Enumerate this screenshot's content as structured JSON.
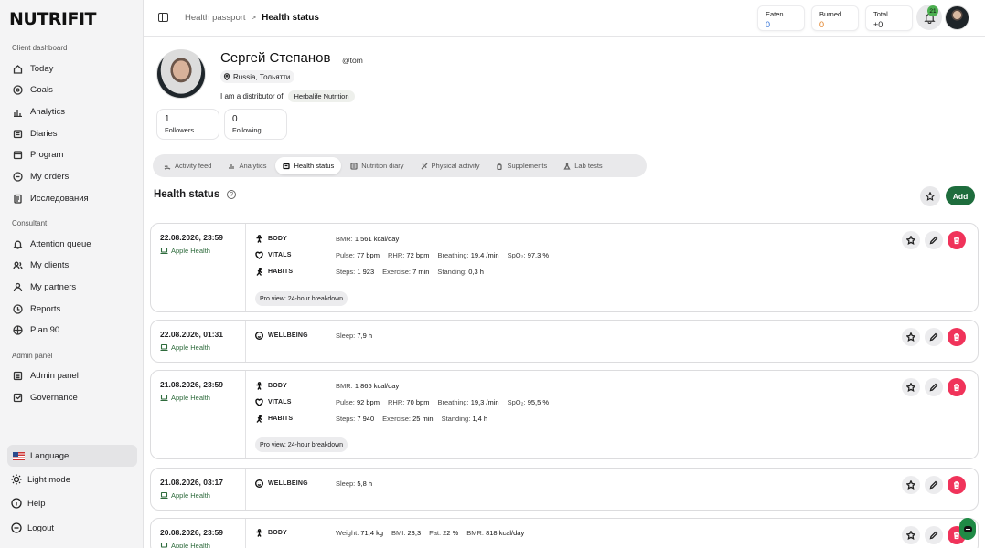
{
  "brand": "NUTRIFIT",
  "sidebar": {
    "section_client": "Client dashboard",
    "client_items": [
      {
        "label": "Today",
        "icon": "home-icon"
      },
      {
        "label": "Goals",
        "icon": "target-icon"
      },
      {
        "label": "Analytics",
        "icon": "bar-chart-icon"
      },
      {
        "label": "Diaries",
        "icon": "diary-icon"
      },
      {
        "label": "Program",
        "icon": "calendar-icon"
      },
      {
        "label": "My orders",
        "icon": "orders-icon"
      },
      {
        "label": "Исследования",
        "icon": "research-icon"
      }
    ],
    "section_consultant": "Consultant",
    "consultant_items": [
      {
        "label": "Attention queue",
        "icon": "bell-icon"
      },
      {
        "label": "My clients",
        "icon": "users-icon"
      },
      {
        "label": "My partners",
        "icon": "partners-icon"
      },
      {
        "label": "Reports",
        "icon": "reports-icon"
      },
      {
        "label": "Plan 90",
        "icon": "plan-icon"
      }
    ],
    "section_admin": "Admin panel",
    "admin_items": [
      {
        "label": "Admin panel",
        "icon": "admin-icon"
      },
      {
        "label": "Governance",
        "icon": "governance-icon"
      }
    ],
    "language": "Language",
    "light_mode": "Light mode",
    "help": "Help",
    "logout": "Logout"
  },
  "topbar": {
    "breadcrumb_parent": "Health passport",
    "breadcrumb_sep": ">",
    "breadcrumb_current": "Health status",
    "eaten_label": "Eaten",
    "eaten_value": "0",
    "burned_label": "Burned",
    "burned_value": "0",
    "total_label": "Total",
    "total_value": "+0",
    "notifications": "21"
  },
  "profile": {
    "name": "Сергей Степанов",
    "handle": "@tom",
    "location": "Russia, Тольятти",
    "distributor_text": "I am a distributor of",
    "distributor_tag": "Herbalife Nutrition",
    "followers_count": "1",
    "followers_label": "Followers",
    "following_count": "0",
    "following_label": "Following"
  },
  "tabs": [
    {
      "label": "Activity feed",
      "active": false
    },
    {
      "label": "Analytics",
      "active": false
    },
    {
      "label": "Health status",
      "active": true
    },
    {
      "label": "Nutrition diary",
      "active": false
    },
    {
      "label": "Physical activity",
      "active": false
    },
    {
      "label": "Supplements",
      "active": false
    },
    {
      "label": "Lab tests",
      "active": false
    }
  ],
  "page": {
    "title": "Health status",
    "add_label": "Add"
  },
  "colors": {
    "accent_green": "#1e6d3d",
    "delete_red": "#f0335a",
    "eaten_blue": "#2f6fd6",
    "burned_orange": "#e07a1a"
  },
  "records": [
    {
      "date": "22.08.2026, 23:59",
      "source": "Apple Health",
      "rows": [
        {
          "cat": "BODY",
          "metrics": [
            [
              "BMR:",
              "1 561 kcal/day"
            ]
          ]
        },
        {
          "cat": "VITALS",
          "metrics": [
            [
              "Pulse:",
              "77 bpm"
            ],
            [
              "RHR:",
              "72 bpm"
            ],
            [
              "Breathing:",
              "19,4 /min"
            ],
            [
              "SpO₂:",
              "97,3 %"
            ]
          ]
        },
        {
          "cat": "HABITS",
          "metrics": [
            [
              "Steps:",
              "1 923"
            ],
            [
              "Exercise:",
              "7 min"
            ],
            [
              "Standing:",
              "0,3 h"
            ]
          ]
        }
      ],
      "pro": "Pro view: 24-hour breakdown"
    },
    {
      "date": "22.08.2026, 01:31",
      "source": "Apple Health",
      "rows": [
        {
          "cat": "WELLBEING",
          "metrics": [
            [
              "Sleep:",
              "7,9 h"
            ]
          ]
        }
      ]
    },
    {
      "date": "21.08.2026, 23:59",
      "source": "Apple Health",
      "rows": [
        {
          "cat": "BODY",
          "metrics": [
            [
              "BMR:",
              "1 865 kcal/day"
            ]
          ]
        },
        {
          "cat": "VITALS",
          "metrics": [
            [
              "Pulse:",
              "92 bpm"
            ],
            [
              "RHR:",
              "70 bpm"
            ],
            [
              "Breathing:",
              "19,3 /min"
            ],
            [
              "SpO₂:",
              "95,5 %"
            ]
          ]
        },
        {
          "cat": "HABITS",
          "metrics": [
            [
              "Steps:",
              "7 940"
            ],
            [
              "Exercise:",
              "25 min"
            ],
            [
              "Standing:",
              "1,4 h"
            ]
          ]
        }
      ],
      "pro": "Pro view: 24-hour breakdown"
    },
    {
      "date": "21.08.2026, 03:17",
      "source": "Apple Health",
      "rows": [
        {
          "cat": "WELLBEING",
          "metrics": [
            [
              "Sleep:",
              "5,8 h"
            ]
          ]
        }
      ]
    },
    {
      "date": "20.08.2026, 23:59",
      "source": "Apple Health",
      "rows": [
        {
          "cat": "BODY",
          "metrics": [
            [
              "Weight:",
              "71,4 kg"
            ],
            [
              "BMI:",
              "23,3"
            ],
            [
              "Fat:",
              "22 %"
            ],
            [
              "BMR:",
              "818 kcal/day"
            ]
          ]
        }
      ]
    }
  ]
}
